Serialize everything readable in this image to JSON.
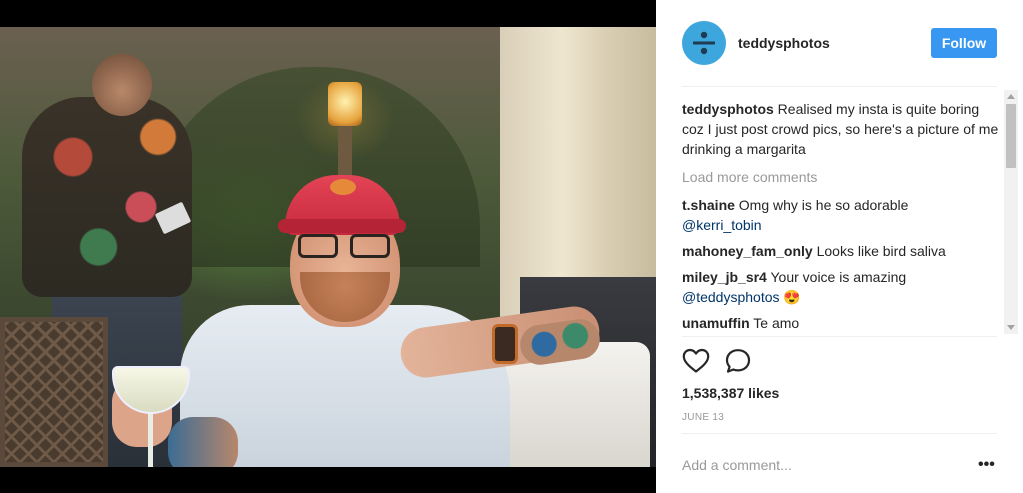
{
  "post": {
    "username": "teddysphotos",
    "follow_label": "Follow",
    "caption": {
      "username": "teddysphotos",
      "text": "Realised my insta is quite boring coz I just post crowd pics, so here's a picture of me drinking a margarita"
    },
    "load_more_label": "Load more comments",
    "comments": [
      {
        "username": "t.shaine",
        "text": "Omg why is he so adorable",
        "mention": "@kerri_tobin"
      },
      {
        "username": "mahoney_fam_only",
        "text": "Looks like bird saliva"
      },
      {
        "username": "miley_jb_sr4",
        "text": "Your voice is amazing",
        "mention": "@teddysphotos",
        "emoji": "😍"
      },
      {
        "username": "unamuffin",
        "text": "Te amo"
      }
    ],
    "likes": "1,538,387 likes",
    "date": "JUNE 13",
    "add_comment_placeholder": "Add a comment...",
    "more_options": "•••"
  },
  "icons": {
    "like": "heart-outline-icon",
    "comment": "speech-bubble-icon",
    "avatar_logo": "divide-symbol-logo"
  },
  "colors": {
    "follow_button": "#3897f0",
    "avatar_bg": "#3da7dd",
    "mention": "#003569",
    "muted": "#999999"
  }
}
